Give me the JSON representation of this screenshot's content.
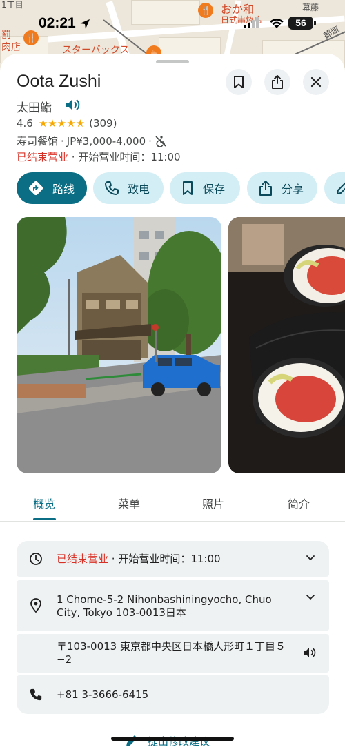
{
  "status_bar": {
    "time": "02:21",
    "battery": "56"
  },
  "map": {
    "labels": {
      "street": "1丁目",
      "left_top": "罰",
      "left_bottom": "肉店",
      "poi_name": "おか和",
      "poi_sub": "日式串烧店",
      "starbucks": "スターバックス",
      "road": "都道",
      "ward": "幕藤"
    }
  },
  "place": {
    "name": "Oota Zushi",
    "native_name": "太田鮨",
    "rating": "4.6",
    "stars": "★★★★★",
    "review_count": "(309)",
    "category": "寿司餐馆",
    "sep": "·",
    "price": "JP¥3,000-4,000",
    "status_closed": "已结束营业",
    "opens": "· 开始营业时间：11:00"
  },
  "actions": {
    "directions": "路线",
    "call": "致电",
    "save": "保存",
    "share": "分享"
  },
  "tabs": {
    "overview": "概览",
    "menu": "菜单",
    "photos": "照片",
    "about": "简介"
  },
  "details": {
    "hours_closed": "已结束营业",
    "hours_open": "· 开始营业时间：11:00",
    "address_line1": "1 Chome-5-2 Nihonbashiningyocho, Chuo",
    "address_line2": "City, Tokyo 103-0013日本",
    "native_address_line1": "〒103-0013 東京都中央区日本橋人形町１丁目５",
    "native_address_line2": "−2",
    "phone": "+81 3-3666-6415"
  },
  "suggest_edit": "提出修改建议",
  "colors": {
    "accent": "#0b6e84",
    "chip_bg": "#d3eef5",
    "closed_red": "#d93025",
    "star": "#f6a800",
    "card_bg": "#eef2f3"
  },
  "icons": [
    "location-arrow-icon",
    "signal-icon",
    "wifi-icon",
    "bookmark-icon",
    "share-icon",
    "close-icon",
    "speaker-icon",
    "no-wheelchair-icon",
    "directions-icon",
    "phone-icon",
    "pencil-icon",
    "clock-icon",
    "place-pin-icon",
    "chevron-down-icon"
  ]
}
